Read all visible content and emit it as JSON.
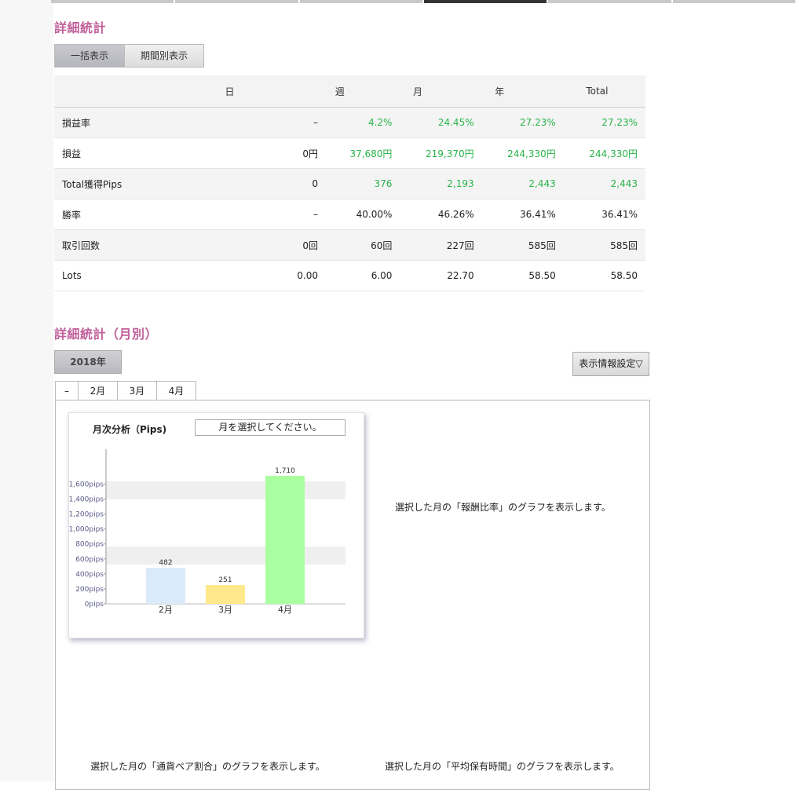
{
  "section1_title": "詳細統計",
  "view_buttons": [
    "一括表示",
    "期間別表示"
  ],
  "stats_table": {
    "headers": [
      "",
      "日",
      "週",
      "月",
      "年",
      "Total"
    ],
    "rows": [
      {
        "label": "損益率",
        "values": [
          "–",
          "4.2%",
          "24.45%",
          "27.23%",
          "27.23%"
        ],
        "green": [
          false,
          true,
          true,
          true,
          true
        ]
      },
      {
        "label": "損益",
        "values": [
          "0円",
          "37,680円",
          "219,370円",
          "244,330円",
          "244,330円"
        ],
        "green": [
          false,
          true,
          true,
          true,
          true
        ]
      },
      {
        "label": "Total獲得Pips",
        "values": [
          "0",
          "376",
          "2,193",
          "2,443",
          "2,443"
        ],
        "green": [
          false,
          true,
          true,
          true,
          true
        ]
      },
      {
        "label": "勝率",
        "values": [
          "–",
          "40.00%",
          "46.26%",
          "36.41%",
          "36.41%"
        ],
        "green": [
          false,
          false,
          false,
          false,
          false
        ]
      },
      {
        "label": "取引回数",
        "values": [
          "0回",
          "60回",
          "227回",
          "585回",
          "585回"
        ],
        "green": [
          false,
          false,
          false,
          false,
          false
        ]
      },
      {
        "label": "Lots",
        "values": [
          "0.00",
          "6.00",
          "22.70",
          "58.50",
          "58.50"
        ],
        "green": [
          false,
          false,
          false,
          false,
          false
        ]
      }
    ]
  },
  "section2_title": "詳細統計（月別）",
  "year_button": "2018年",
  "display_settings_button": "表示情報設定▽",
  "month_tabs": [
    "–",
    "2月",
    "3月",
    "4月"
  ],
  "chart_panel": {
    "title": "月次分析（Pips)",
    "select_placeholder": "月を選択してください。"
  },
  "placeholders": {
    "reward_ratio": "選択した月の「報酬比率」のグラフを表示します。",
    "currency_pair": "選択した月の「通貨ペア割合」のグラフを表示します。",
    "holding_time": "選択した月の「平均保有時間」のグラフを表示します。"
  },
  "colors": {
    "title_pink": "#c0609a",
    "positive_green": "#28b44a",
    "bar_feb": "#dbeafa",
    "bar_mar": "#ffe98a",
    "bar_apr": "#aaffa0"
  },
  "chart_data": {
    "type": "bar",
    "categories": [
      "2月",
      "3月",
      "4月"
    ],
    "values": [
      482,
      251,
      1710
    ],
    "data_labels": [
      "482",
      "251",
      "1,710"
    ],
    "y_ticks": [
      "0pips",
      "200pips",
      "400pips",
      "600pips",
      "800pips",
      "1,000pips",
      "1,200pips",
      "1,400pips",
      "1,600pips"
    ],
    "ylim": [
      0,
      1800
    ],
    "bar_colors": [
      "#dbeafa",
      "#ffe98a",
      "#aaffa0"
    ]
  }
}
